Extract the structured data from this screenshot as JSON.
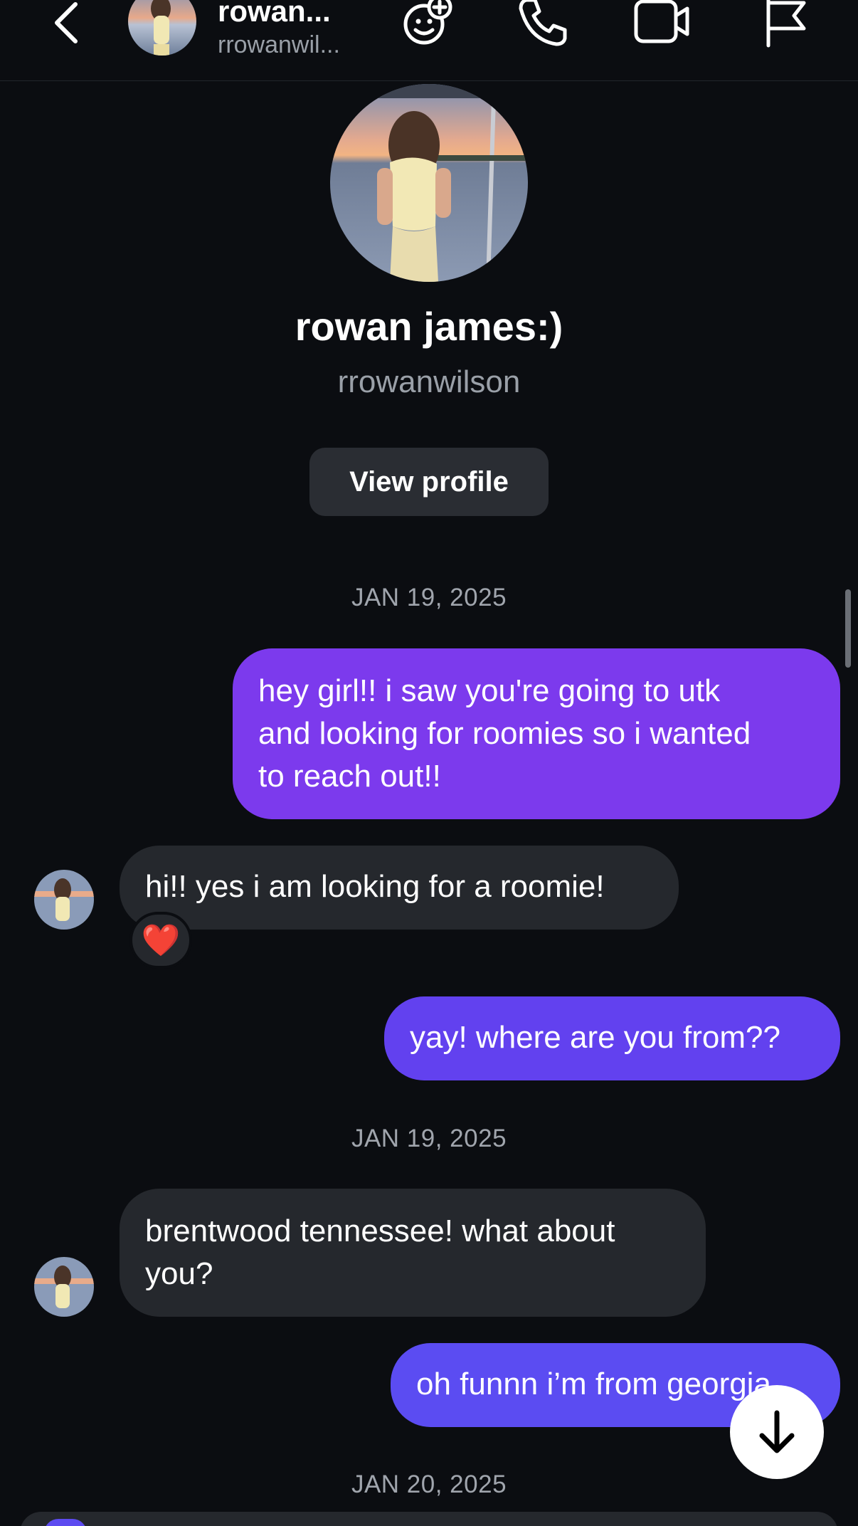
{
  "header": {
    "name": "rowan...",
    "username": "rrowanwil..."
  },
  "profile": {
    "name": "rowan james:)",
    "username": "rrowanwilson",
    "view_profile_label": "View profile"
  },
  "messages": [
    {
      "type": "date",
      "text": "JAN 19, 2025"
    },
    {
      "type": "outgoing",
      "lines": [
        "hey girl!! i saw you're going to utk",
        "and looking for roomies so i wanted",
        "to reach out!!"
      ]
    },
    {
      "type": "incoming",
      "lines": [
        "hi!! yes i am looking for a roomie!"
      ],
      "reaction": "❤️"
    },
    {
      "type": "outgoing",
      "lines": [
        "yay! where are you from??"
      ]
    },
    {
      "type": "date",
      "text": "JAN 19, 2025"
    },
    {
      "type": "incoming",
      "lines": [
        "brentwood tennessee! what about",
        "you?"
      ]
    },
    {
      "type": "outgoing",
      "lines": [
        "oh funnn i’m from georgia"
      ]
    },
    {
      "type": "date",
      "text": "JAN 20, 2025"
    }
  ],
  "colors": {
    "background": "#0b0d11",
    "incoming_bubble": "#25282d",
    "outgoing_bubble_top": "#7c3aed",
    "outgoing_bubble_bottom": "#5b4cf2"
  },
  "icons": [
    "back-icon",
    "add-friend-effect-icon",
    "phone-icon",
    "video-icon",
    "flag-icon",
    "arrow-down-icon"
  ]
}
